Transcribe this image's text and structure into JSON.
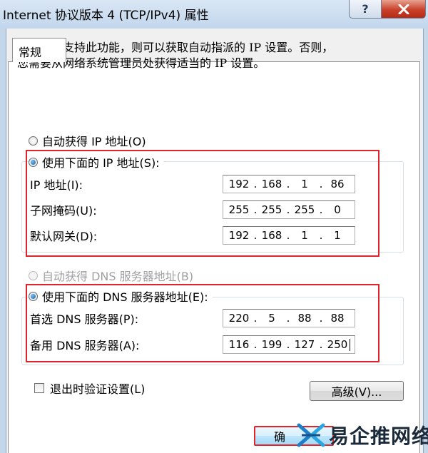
{
  "window": {
    "title": "Internet 协议版本 4 (TCP/IPv4) 属性",
    "help_label": "?"
  },
  "tabs": [
    {
      "label": "常规"
    }
  ],
  "description": {
    "line1": "如果网络支持此功能，则可以获取自动指派的 IP 设置。否则，",
    "line2": "您需要从网络系统管理员处获得适当的 IP 设置。"
  },
  "ip_section": {
    "auto_label": "自动获得 IP 地址(O)",
    "manual_label": "使用下面的 IP 地址(S):",
    "selected": "manual",
    "fields": [
      {
        "label": "IP 地址(I):",
        "octets": [
          "192",
          "168",
          "1",
          "86"
        ]
      },
      {
        "label": "子网掩码(U):",
        "octets": [
          "255",
          "255",
          "255",
          "0"
        ]
      },
      {
        "label": "默认网关(D):",
        "octets": [
          "192",
          "168",
          "1",
          "1"
        ]
      }
    ]
  },
  "dns_section": {
    "auto_label": "自动获得 DNS 服务器地址(B)",
    "manual_label": "使用下面的 DNS 服务器地址(E):",
    "selected": "manual",
    "auto_disabled": true,
    "fields": [
      {
        "label": "首选 DNS 服务器(P):",
        "octets": [
          "220",
          "5",
          "88",
          "88"
        ]
      },
      {
        "label": "备用 DNS 服务器(A):",
        "octets": [
          "116",
          "199",
          "127",
          "250"
        ]
      }
    ]
  },
  "validate_on_exit": {
    "label": "退出时验证设置(L)",
    "checked": false
  },
  "buttons": {
    "advanced": "高级(V)...",
    "ok": "确"
  },
  "watermark": {
    "text": "易企推网络"
  },
  "colors": {
    "highlight_border": "#e0242c",
    "title_bg": "#c2d6ec",
    "close_button": "#c8402a"
  },
  "icons": {
    "close": "close-x-icon",
    "watermark_logo": "x-logo-icon"
  }
}
